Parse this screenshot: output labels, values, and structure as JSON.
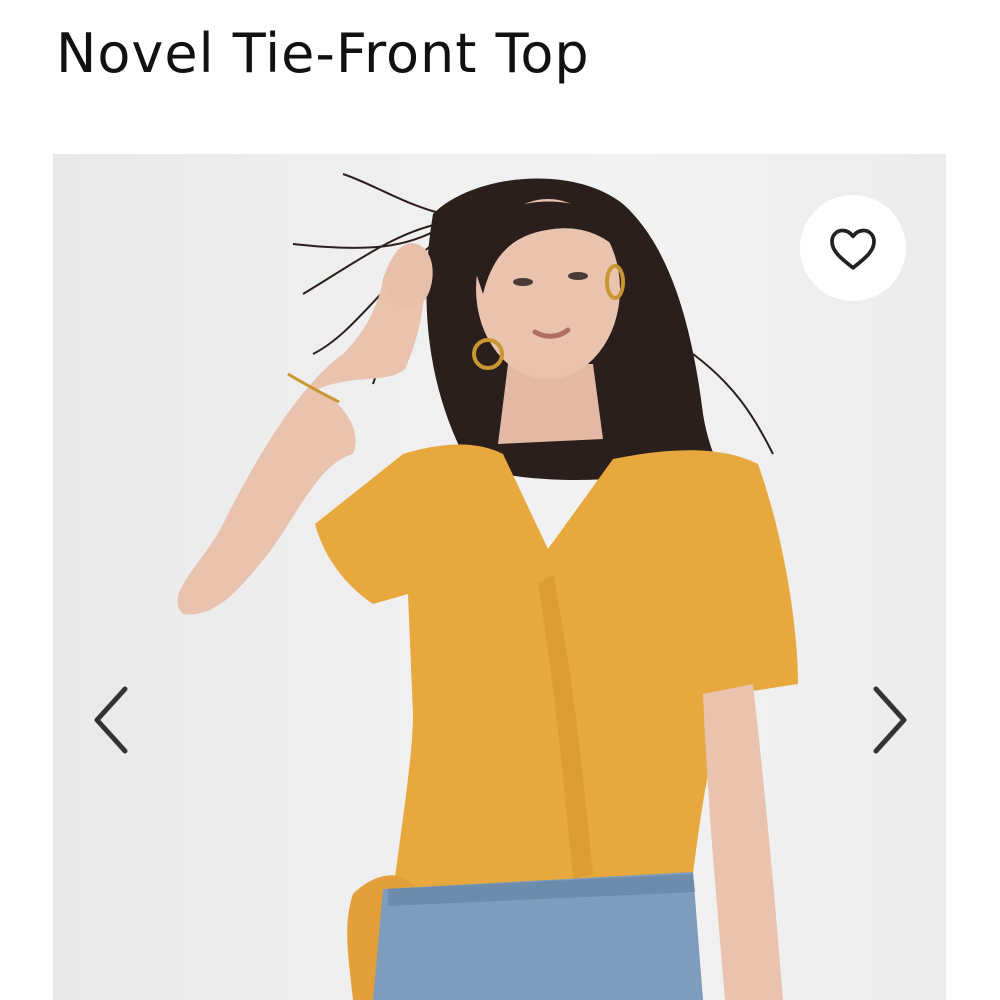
{
  "product": {
    "title": "Novel Tie-Front Top"
  },
  "gallery": {
    "image_subject": "model wearing mustard yellow tie-front top with blue jeans",
    "favorite_icon": "heart-outline-icon",
    "prev_icon": "chevron-left-icon",
    "next_icon": "chevron-right-icon"
  },
  "colors": {
    "top": "#E7A83D",
    "denim": "#7E9CBB",
    "hair": "#2A1F1C",
    "skin": "#E9C3AE",
    "icon": "#222222"
  }
}
